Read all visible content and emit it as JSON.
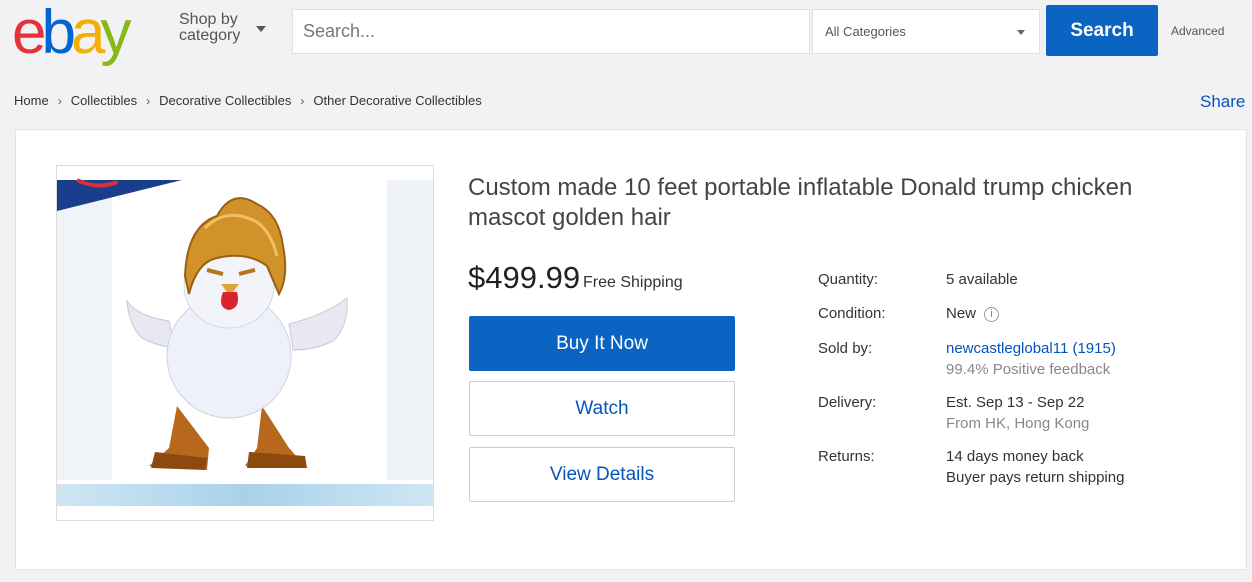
{
  "header": {
    "logo": {
      "e": "e",
      "b": "b",
      "a": "a",
      "y": "y"
    },
    "shop_by_line1": "Shop by",
    "shop_by_line2": "category",
    "search_placeholder": "Search...",
    "category_selected": "All Categories",
    "search_button": "Search",
    "advanced_link": "Advanced"
  },
  "breadcrumb": {
    "items": [
      "Home",
      "Collectibles",
      "Decorative Collectibles",
      "Other Decorative Collectibles"
    ],
    "separator": "›"
  },
  "share_link": "Share",
  "listing": {
    "title": "Custom made 10 feet portable inflatable Donald trump chicken mascot golden hair",
    "price": "$499.99",
    "shipping": "Free Shipping",
    "buy_button": "Buy It Now",
    "watch_button": "Watch",
    "details_button": "View Details",
    "details": {
      "quantity_label": "Quantity:",
      "quantity_value": "5 available",
      "condition_label": "Condition:",
      "condition_value": "New",
      "condition_info_icon": "i",
      "sold_by_label": "Sold by:",
      "seller_name": "newcastleglobal11 (1915)",
      "seller_feedback": "99.4% Positive feedback",
      "delivery_label": "Delivery:",
      "delivery_estimate": "Est. Sep 13 - Sep 22",
      "delivery_origin": "From HK, Hong Kong",
      "returns_label": "Returns:",
      "returns_policy": "14 days money back",
      "returns_shipping": "Buyer pays return shipping"
    }
  },
  "colors": {
    "ebay_red": "#e53238",
    "ebay_blue": "#0064d2",
    "ebay_yellow": "#f5af02",
    "ebay_green": "#86b817",
    "button_blue": "#0b63c2",
    "link_blue": "#0654ba"
  },
  "icons": [
    "chevron-down-icon",
    "info-icon",
    "product-image"
  ]
}
